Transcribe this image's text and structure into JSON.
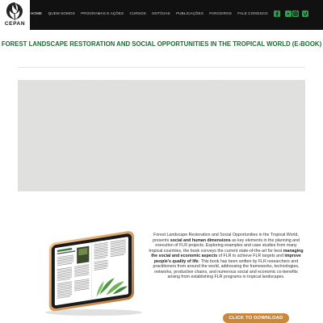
{
  "header": {
    "logo_text": "CEPAN",
    "nav": [
      "HOME",
      "QUEM SOMOS",
      "PROGRAMAS E AÇÕES",
      "CURSOS",
      "NOTÍCIAS",
      "PUBLICAÇÕES",
      "PARCEIROS",
      "FALE CONOSCO"
    ],
    "social_icons": [
      "facebook-icon",
      "youtube-icon",
      "instagram-icon",
      "vimeo-icon"
    ],
    "accent_color": "#2f9e4f"
  },
  "main": {
    "title": "FOREST LANDSCAPE RESTORATION AND SOCIAL OPPORTUNITIES IN THE TROPICAL WORLD (E-BOOK)",
    "description": {
      "t1": "Forest Landscape Restoration and Social Opportunities in the Tropical World, presents ",
      "b1": "social and human dimensions",
      "t2": " as key elements in the planning and execution of FLR projects. Exploring examples and case studies from many tropical countries, the book conveys the current state-of-the-art for best ",
      "b2": "managing the social and economic aspects",
      "t3": " of FLR to achieve FLR targets and ",
      "b3": "improve people’s quality of life",
      "t4": ". This book has been written by FLR researchers and practitioners from around the world, addressing the frameworks, technologies, networks, productive chains, and numerous social and economic co-benefits arising from establishing FLR programs in tropical landscapes."
    },
    "download_label": "CLICK TO DOWNLOAD",
    "button_color": "#c9883d",
    "title_color": "#1c6b2f"
  }
}
